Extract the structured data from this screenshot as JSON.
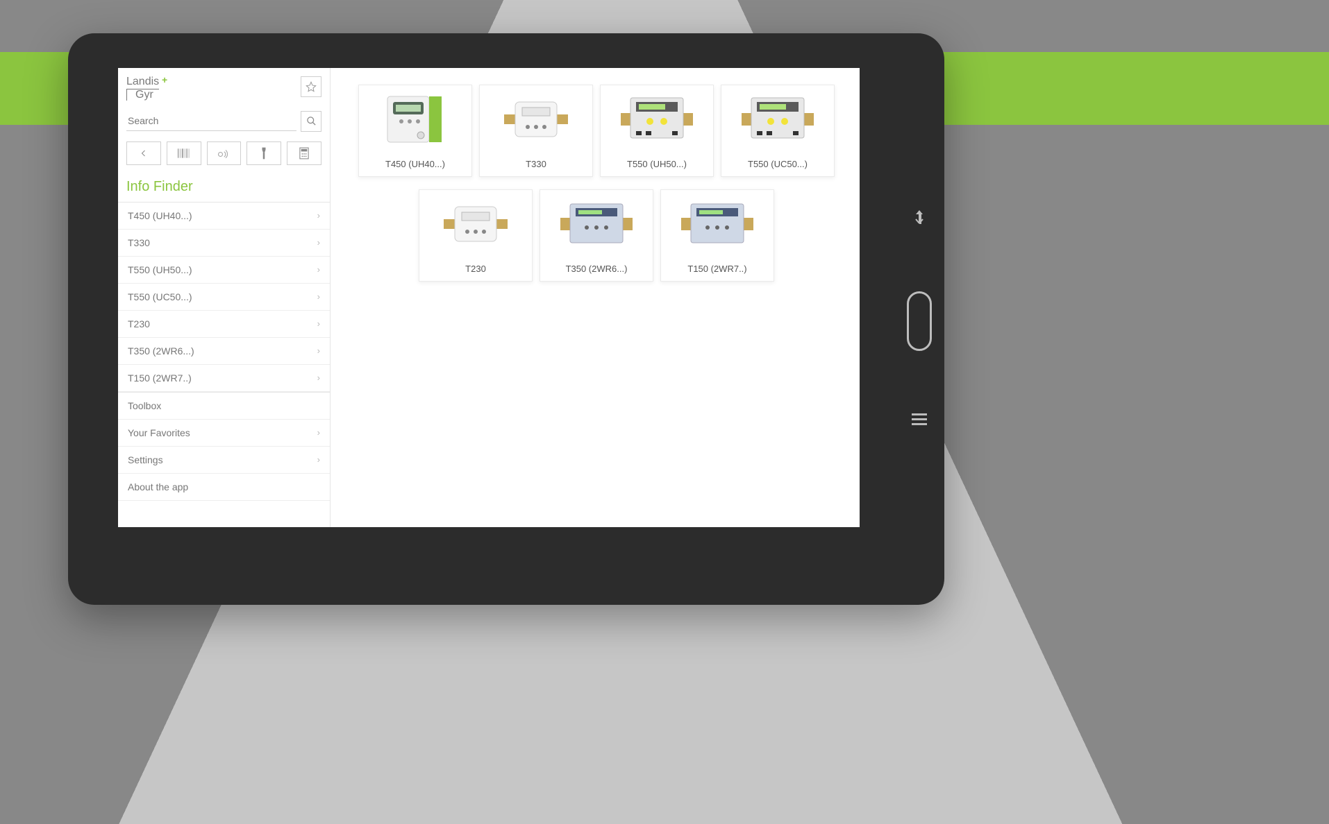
{
  "brand": {
    "line1": "Landis",
    "line2": "Gyr"
  },
  "search": {
    "placeholder": "Search"
  },
  "section_title": "Info Finder",
  "sidebar": {
    "items": [
      {
        "label": "T450 (UH40...)",
        "chev": true
      },
      {
        "label": "T330",
        "chev": true
      },
      {
        "label": "T550 (UH50...)",
        "chev": true
      },
      {
        "label": "T550 (UC50...)",
        "chev": true
      },
      {
        "label": "T230",
        "chev": true
      },
      {
        "label": "T350 (2WR6...)",
        "chev": true
      },
      {
        "label": "T150 (2WR7..)",
        "chev": true
      }
    ],
    "footer": [
      {
        "label": "Toolbox",
        "chev": false
      },
      {
        "label": "Your Favorites",
        "chev": true
      },
      {
        "label": "Settings",
        "chev": true
      },
      {
        "label": "About the app",
        "chev": false
      }
    ]
  },
  "products": [
    {
      "label": "T450 (UH40...)",
      "variant": "green"
    },
    {
      "label": "T330",
      "variant": "pipe-white"
    },
    {
      "label": "T550 (UH50...)",
      "variant": "wall-yellow"
    },
    {
      "label": "T550 (UC50...)",
      "variant": "wall-yellow"
    },
    {
      "label": "T230",
      "variant": "pipe-white"
    },
    {
      "label": "T350 (2WR6...)",
      "variant": "wall-blue"
    },
    {
      "label": "T150 (2WR7..)",
      "variant": "wall-blue"
    }
  ]
}
